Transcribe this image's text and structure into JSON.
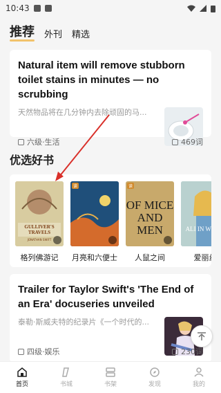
{
  "status_bar": {
    "time": "10:43"
  },
  "top_tabs": [
    {
      "label": "推荐",
      "active": true
    },
    {
      "label": "外刊",
      "active": false
    },
    {
      "label": "精选",
      "active": false
    }
  ],
  "article1": {
    "title": "Natural item will remove stubborn toilet stains in minutes — no scrubbing",
    "desc": "天然物品将在几分钟内去除顽固的马...",
    "level": "六级·生活",
    "words": "469词"
  },
  "books_section": {
    "title": "优选好书",
    "books": [
      {
        "title": "格列佛游记"
      },
      {
        "title": "月亮和六便士"
      },
      {
        "title": "人鼠之间"
      },
      {
        "title": "爱丽丝"
      }
    ],
    "covers": {
      "gulliver_title": "GULLIVER'S TRAVELS",
      "gulliver_author": "JONATHAN SWIFT",
      "mice_title": "OF MICE AND MEN",
      "alice_title": "ALI IN WOND"
    }
  },
  "article2": {
    "title": "Trailer for Taylor Swift's 'The End of an Era' docuseries unveiled",
    "desc": "泰勒·斯威夫特的纪录片《一个时代的...",
    "level": "四级·娱乐",
    "words": "230词"
  },
  "bottom_nav": [
    {
      "label": "首页",
      "active": true
    },
    {
      "label": "书城",
      "active": false
    },
    {
      "label": "书架",
      "active": false
    },
    {
      "label": "发现",
      "active": false
    },
    {
      "label": "我的",
      "active": false
    }
  ],
  "colors": {
    "accent": "#f1c26b",
    "arrow": "#d9302a"
  }
}
